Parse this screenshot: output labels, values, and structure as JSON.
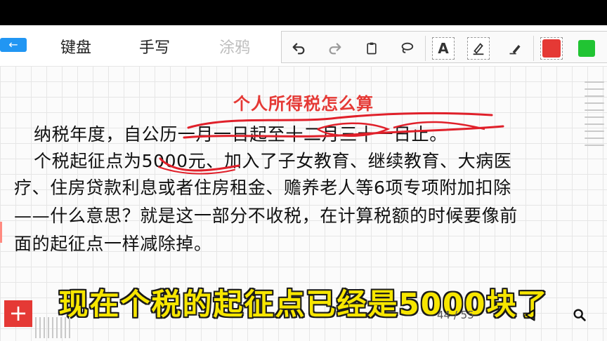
{
  "toolbar": {
    "modes": [
      {
        "label": "键盘"
      },
      {
        "label": "手写"
      },
      {
        "label": "涂鸦"
      }
    ],
    "tools": {
      "text_tool_label": "A",
      "color_primary": "#e53935",
      "color_secondary": "#21c433"
    }
  },
  "document": {
    "title": "个人所得税怎么算",
    "lines": [
      "纳税年度，自公历一月一日起至十二月三十一日止。",
      "个税起征点为5000元、加入了子女教育、继续教育、大病医",
      "疗、住房贷款利息或者住房租金、赡养老人等6项专项附加扣除",
      "——什么意思？就是这一部分不收税，在计算税额的时候要像前",
      "面的起征点一样减除掉。"
    ]
  },
  "subtitle": "现在个税的起征点已经是5000块了",
  "footer": {
    "page_counter": "44 / 55",
    "add_label": "+"
  },
  "colors": {
    "title_red": "#e53935",
    "ink_red": "#e0202a",
    "subtitle_yellow": "#f7e600",
    "accent_blue": "#2196f3"
  }
}
